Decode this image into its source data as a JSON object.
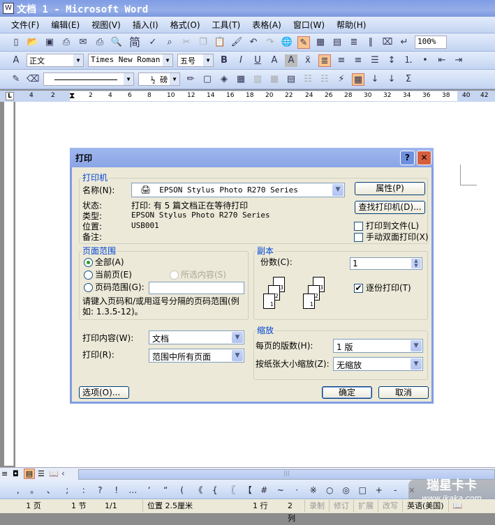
{
  "window": {
    "title": "文档 1 - Microsoft Word"
  },
  "menu": [
    "文件(F)",
    "编辑(E)",
    "视图(V)",
    "插入(I)",
    "格式(O)",
    "工具(T)",
    "表格(A)",
    "窗口(W)",
    "帮助(H)"
  ],
  "toolbar": {
    "zoom": "100%",
    "jian": "简",
    "style": "正文",
    "font": "Times New Roman",
    "size": "五号",
    "line_weight": "½ 磅"
  },
  "ruler": {
    "numbers": [
      "4",
      "2",
      "2",
      "4",
      "6",
      "8",
      "10",
      "12",
      "14",
      "16",
      "18",
      "20",
      "22",
      "24",
      "26",
      "28",
      "30",
      "32",
      "34",
      "36",
      "38",
      "40",
      "42"
    ]
  },
  "symbols": [
    ",",
    "。",
    "、",
    ";",
    ":",
    "?",
    "!",
    "…",
    "‘",
    "“",
    "(",
    "《",
    "{",
    "〖",
    "【",
    "#",
    "~",
    "·",
    "※",
    "○",
    "◎",
    "□",
    "+",
    "-",
    "×"
  ],
  "watermark": {
    "name": "瑞星卡卡",
    "url": "www.ikaka.com"
  },
  "status": {
    "page": "1 页",
    "section": "1 节",
    "pages": "1/1",
    "position": "位置 2.5厘米",
    "line": "1 行",
    "col": "2 列",
    "rec": "录制",
    "trk": "修订",
    "ext": "扩展",
    "ovr": "改写",
    "lang": "英语(美国)"
  },
  "dialog": {
    "title": "打印",
    "help": "?",
    "close": "✕",
    "printer": {
      "group": "打印机",
      "name_label": "名称(N):",
      "name": "EPSON Stylus Photo R270 Series",
      "props": "属性(P)",
      "find": "查找打印机(D)...",
      "status_label": "状态:",
      "status": "打印: 有 5 篇文档正在等待打印",
      "type_label": "类型:",
      "type": "EPSON Stylus Photo R270 Series",
      "where_label": "位置:",
      "where": "USB001",
      "comment_label": "备注:",
      "to_file": "打印到文件(L)",
      "duplex": "手动双面打印(X)"
    },
    "range": {
      "group": "页面范围",
      "all": "全部(A)",
      "current": "当前页(E)",
      "selection": "所选内容(S)",
      "pages": "页码范围(G):",
      "pages_value": "",
      "hint": "请键入页码和/或用逗号分隔的页码范围(例如: 1.3.5-12)。"
    },
    "copies": {
      "group": "副本",
      "label": "份数(C):",
      "value": "1",
      "collate": "逐份打印(T)",
      "collate_checked": true
    },
    "what_label": "打印内容(W):",
    "what": "文档",
    "print_label": "打印(R):",
    "print": "范围中所有页面",
    "zoom": {
      "group": "缩放",
      "per_page_label": "每页的版数(H):",
      "per_page": "1 版",
      "scale_label": "按纸张大小缩放(Z):",
      "scale": "无缩放"
    },
    "options": "选项(O)...",
    "ok": "确定",
    "cancel": "取消"
  }
}
